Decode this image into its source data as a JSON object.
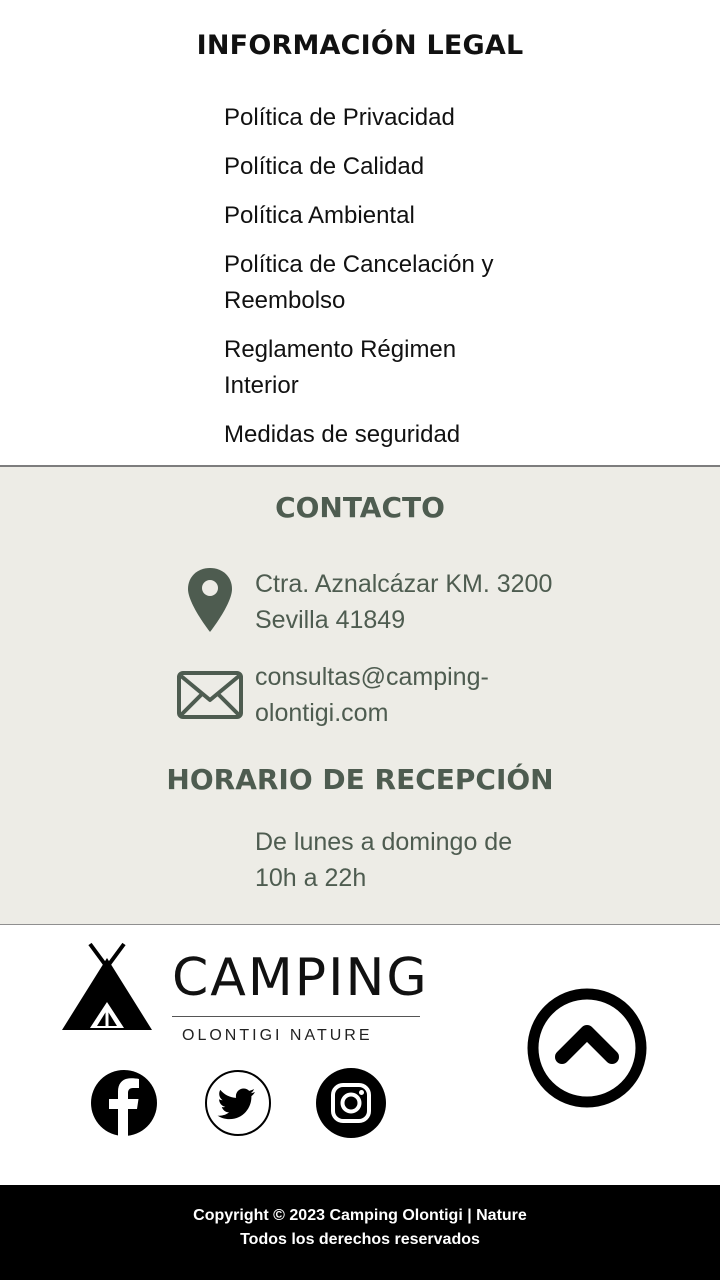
{
  "legal": {
    "title": "INFORMACIÓN LEGAL",
    "links": [
      "Política de Privacidad",
      "Política de Calidad",
      "Política Ambiental",
      "Política de Cancelación y Reembolso",
      "Reglamento Régimen Interior",
      "Medidas de seguridad"
    ]
  },
  "contact": {
    "title": "CONTACTO",
    "address": "Ctra. Aznalcázar KM. 3200 Sevilla 41849",
    "email": "consultas@camping-olontigi.com",
    "hours_title": "HORARIO DE RECEPCIÓN",
    "hours_text": "De lunes a domingo de 10h a 22h",
    "accent_color": "#4e5c50",
    "background_color": "#edece6"
  },
  "logo": {
    "word": "CAMPING",
    "sub": "OLONTIGI NATURE"
  },
  "social": {
    "icons": [
      "facebook-icon",
      "twitter-icon",
      "instagram-icon"
    ]
  },
  "scroll_top": {
    "icon": "chevron-up-circle-icon"
  },
  "copyright": {
    "line1": "Copyright © 2023 Camping Olontigi | Nature",
    "line2": "Todos los derechos reservados"
  }
}
